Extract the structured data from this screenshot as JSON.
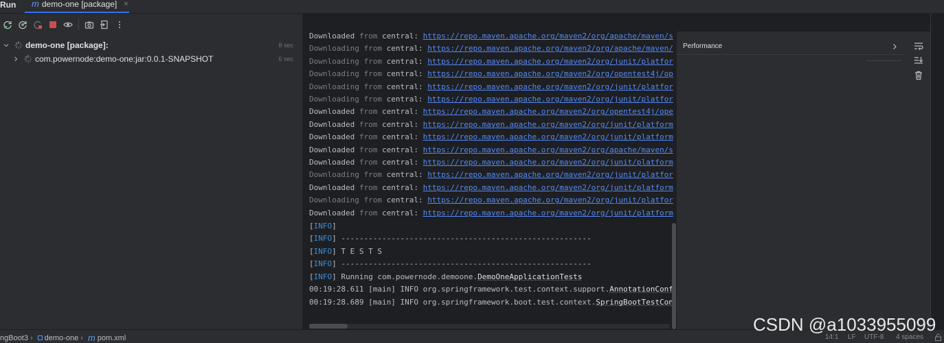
{
  "header": {
    "run_title": "Run",
    "tab": {
      "icon": "maven-m-icon",
      "label": "demo-one [package]",
      "close_glyph": "×"
    }
  },
  "toolbar": {
    "buttons": [
      "rerun-icon",
      "rerun-failed-icon",
      "stop-and-rerun-icon",
      "stop-icon",
      "eye-icon",
      "camera-icon",
      "exit-icon",
      "more-icon"
    ],
    "colors": {
      "stop": "#c94f4f",
      "green": "#5fb865"
    }
  },
  "tree": {
    "items": [
      {
        "label": "demo-one [package]:",
        "time": "8 sec"
      },
      {
        "label": "com.powernode:demo-one:jar:0.0.1-SNAPSHOT",
        "time": "6 sec"
      }
    ]
  },
  "console": {
    "lines": [
      {
        "kind": "Downloaded",
        "from": "from",
        "repo": "central",
        "url": "https://repo.maven.apache.org/maven2/org/apache/maven/s"
      },
      {
        "kind": "Downloading",
        "from": "from",
        "repo": "central",
        "url": "https://repo.maven.apache.org/maven2/org/apache/maven/"
      },
      {
        "kind": "Downloading",
        "from": "from",
        "repo": "central",
        "url": "https://repo.maven.apache.org/maven2/org/junit/platfor"
      },
      {
        "kind": "Downloading",
        "from": "from",
        "repo": "central",
        "url": "https://repo.maven.apache.org/maven2/org/opentest4j/op"
      },
      {
        "kind": "Downloading",
        "from": "from",
        "repo": "central",
        "url": "https://repo.maven.apache.org/maven2/org/junit/platfor"
      },
      {
        "kind": "Downloading",
        "from": "from",
        "repo": "central",
        "url": "https://repo.maven.apache.org/maven2/org/junit/platfor"
      },
      {
        "kind": "Downloaded",
        "from": "from",
        "repo": "central",
        "url": "https://repo.maven.apache.org/maven2/org/opentest4j/ope"
      },
      {
        "kind": "Downloaded",
        "from": "from",
        "repo": "central",
        "url": "https://repo.maven.apache.org/maven2/org/junit/platform"
      },
      {
        "kind": "Downloaded",
        "from": "from",
        "repo": "central",
        "url": "https://repo.maven.apache.org/maven2/org/junit/platform"
      },
      {
        "kind": "Downloaded",
        "from": "from",
        "repo": "central",
        "url": "https://repo.maven.apache.org/maven2/org/apache/maven/s"
      },
      {
        "kind": "Downloaded",
        "from": "from",
        "repo": "central",
        "url": "https://repo.maven.apache.org/maven2/org/junit/platform"
      },
      {
        "kind": "Downloading",
        "from": "from",
        "repo": "central",
        "url": "https://repo.maven.apache.org/maven2/org/junit/platfor"
      },
      {
        "kind": "Downloaded",
        "from": "from",
        "repo": "central",
        "url": "https://repo.maven.apache.org/maven2/org/junit/platform"
      },
      {
        "kind": "Downloading",
        "from": "from",
        "repo": "central",
        "url": "https://repo.maven.apache.org/maven2/org/junit/platfor"
      },
      {
        "kind": "Downloaded",
        "from": "from",
        "repo": "central",
        "url": "https://repo.maven.apache.org/maven2/org/junit/platform"
      }
    ],
    "info_tag": "INFO",
    "info_lines": [
      "",
      " -------------------------------------------------------",
      "  T E S T S",
      " -------------------------------------------------------"
    ],
    "running_prefix": " Running com.powernode.demoone.",
    "running_class": "DemoOneApplicationTests",
    "log1_prefix": "00:19:28.611 [main] INFO org.springframework.test.context.support.",
    "log1_class": "AnnotationConf",
    "log2_prefix": "00:19:28.689 [main] INFO org.springframework.boot.test.context.",
    "log2_class": "SpringBootTestCon"
  },
  "right_panel": {
    "performance_label": "Performance",
    "icons": [
      "soft-wrap-icon",
      "scroll-to-end-icon",
      "trash-icon"
    ]
  },
  "statusbar": {
    "crumbs": [
      "ngBoot3",
      "demo-one",
      "pom.xml"
    ],
    "position": "14:1",
    "line_sep": "LF",
    "encoding": "UTF-8",
    "indent": "4 spaces"
  },
  "watermark": "CSDN @a1033955099"
}
